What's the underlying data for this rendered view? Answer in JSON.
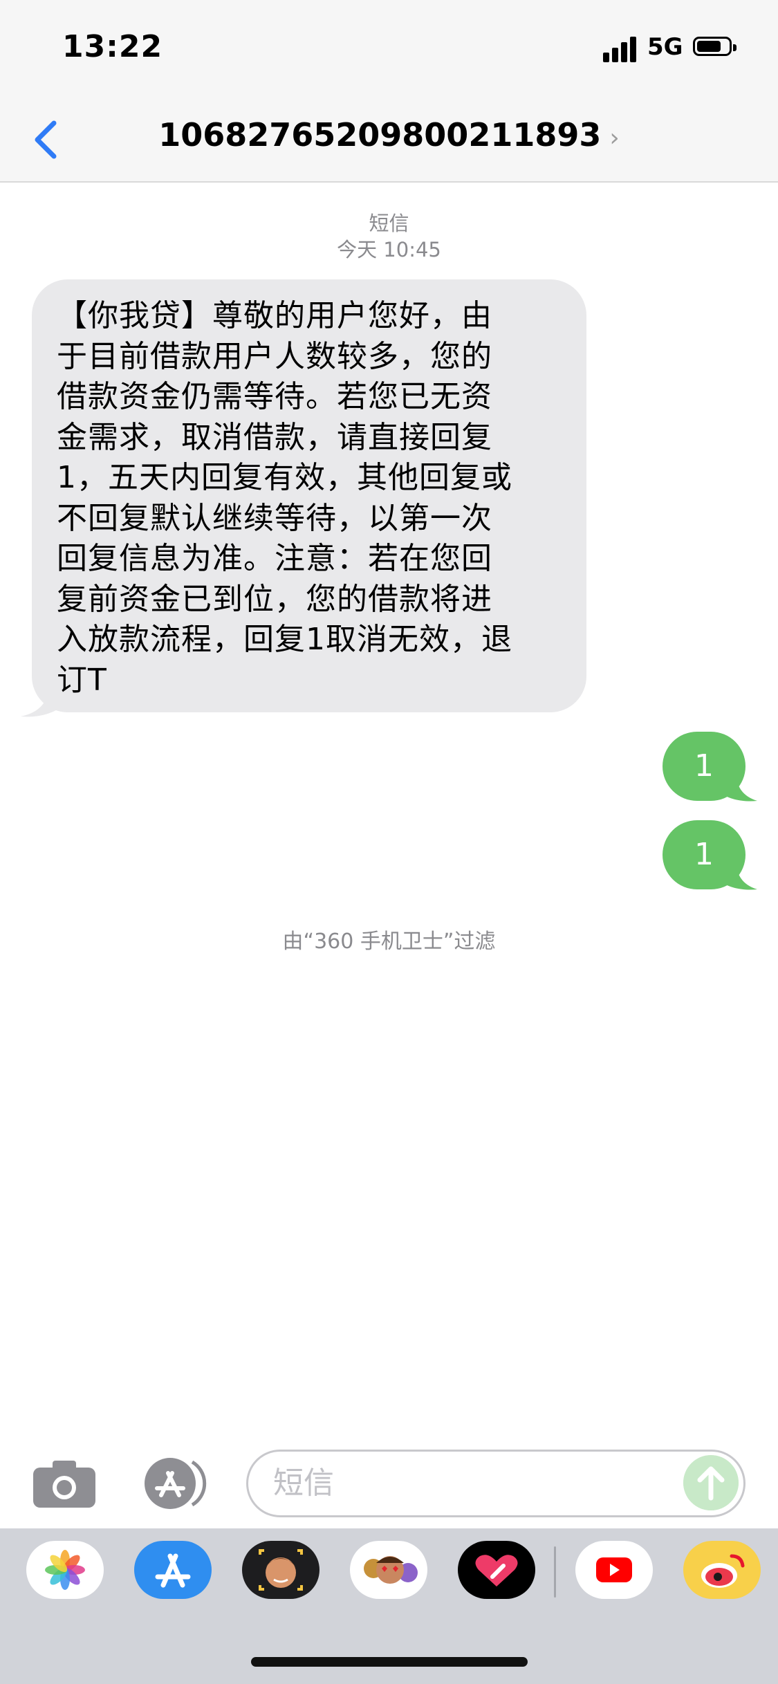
{
  "status_bar": {
    "time": "13:22",
    "network": "5G",
    "battery_level": 0.75,
    "signal_bars": 4
  },
  "header": {
    "contact": "10682765209800211893",
    "chevron": "›",
    "back_icon": "chevron-left-icon"
  },
  "thread": {
    "service": "短信",
    "timestamp": "今天 10:45",
    "incoming_lines": [
      "【你我贷】尊敬的用户您好，由",
      "于目前借款用户人数较多，您的",
      "借款资金仍需等待。若您已无资",
      "金需求，取消借款，请直接回复",
      "1，五天内回复有效，其他回复或",
      "不回复默认继续等待，以第一次",
      "回复信息为准。注意：若在您回",
      "复前资金已到位，您的借款将进",
      "入放款流程，回复1取消无效，退",
      "订T"
    ],
    "outgoing": [
      {
        "text": "1"
      },
      {
        "text": "1"
      }
    ],
    "filter_note": "由“360 手机卫士”过滤"
  },
  "input_bar": {
    "placeholder": "短信",
    "camera_icon": "camera-icon",
    "apps_icon": "app-store-icon",
    "send_icon": "send-arrow-icon"
  },
  "dock": {
    "apps": [
      "photos-app-icon",
      "app-store-app-icon",
      "memoji-app-icon",
      "animoji-app-icon",
      "digital-touch-app-icon",
      "youtube-app-icon",
      "weibo-app-icon"
    ]
  },
  "colors": {
    "incoming_bubble": "#e9e9eb",
    "outgoing_bubble": "#65c466",
    "accent": "#2f7bf6",
    "meta_text": "#8a8a8e"
  }
}
